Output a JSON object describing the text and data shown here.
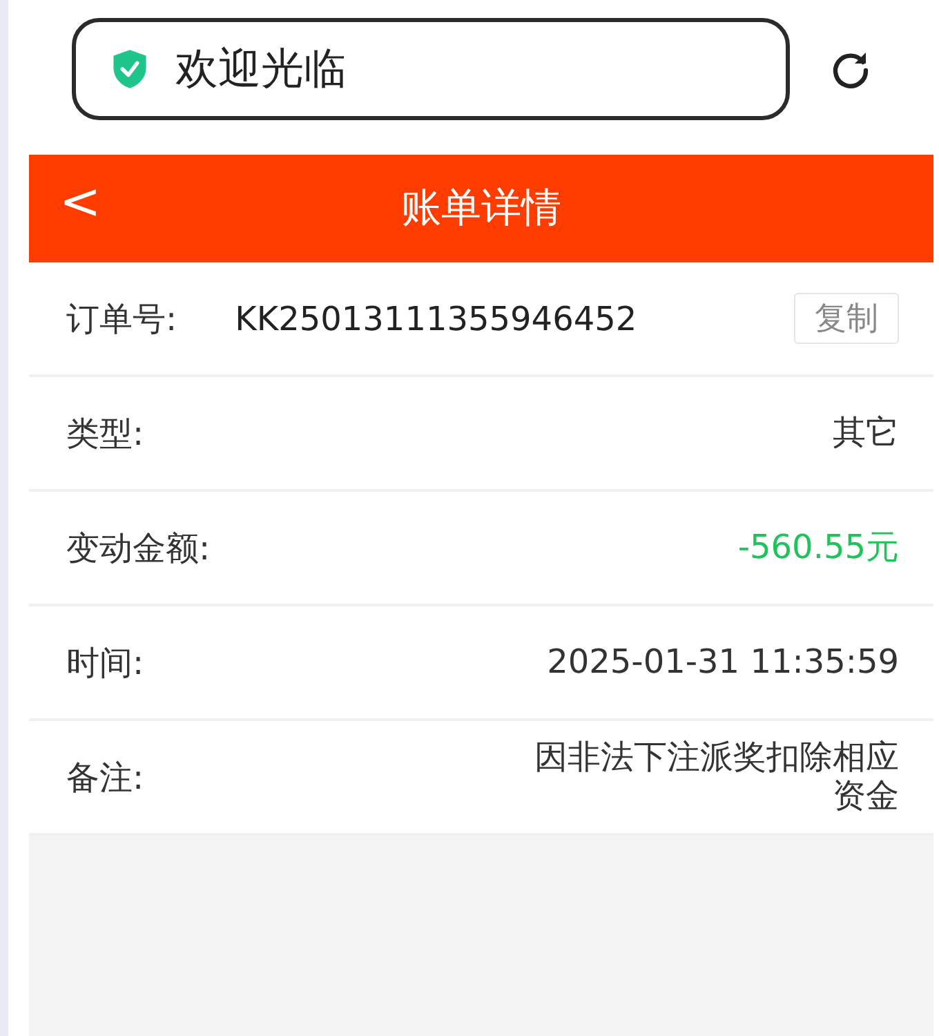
{
  "address_bar": {
    "text": "欢迎光临"
  },
  "header": {
    "back": "<",
    "title": "账单详情"
  },
  "rows": [
    {
      "kind": "copyable",
      "label": "订单号:",
      "value": "KK25013111355946452",
      "action": "复制"
    },
    {
      "kind": "plain",
      "label": "类型:",
      "value": "其它"
    },
    {
      "kind": "plain",
      "label": "变动金额:",
      "value": "-560.55元",
      "color": "#1ec35a"
    },
    {
      "kind": "plain",
      "label": "时间:",
      "value": "2025-01-31 11:35:59"
    },
    {
      "kind": "plain",
      "label": "备注:",
      "value": "因非法下注派奖扣除相应资金"
    }
  ]
}
